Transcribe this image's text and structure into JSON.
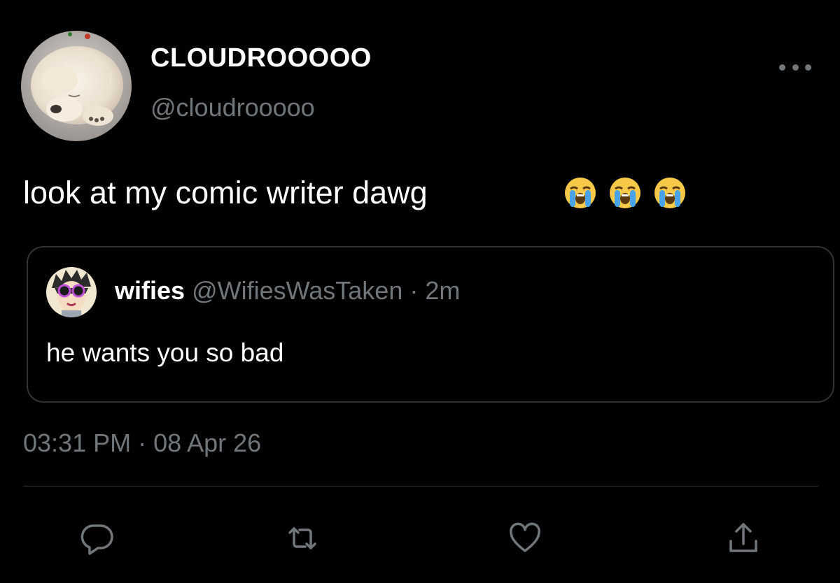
{
  "author": {
    "display_name": "CLOUDROOOOO",
    "handle": "@cloudrooooo",
    "avatar": "fluffy-puppy-avatar"
  },
  "tweet": {
    "text": "look at my comic writer dawg",
    "emojis": [
      "loudly-crying-face-emoji",
      "loudly-crying-face-emoji",
      "loudly-crying-face-emoji"
    ],
    "timestamp": "03:31 PM · 08 Apr 26"
  },
  "quoted_tweet": {
    "display_name": "wifies",
    "meta": "@WifiesWasTaken · 2m",
    "text": "he wants you so bad",
    "avatar": "cartoon-character-avatar"
  },
  "actions": [
    "reply-icon",
    "retweet-icon",
    "like-icon",
    "share-icon"
  ],
  "colors": {
    "background": "#000000",
    "text_primary": "#ffffff",
    "text_secondary": "#71767b",
    "border": "#2f3336"
  }
}
